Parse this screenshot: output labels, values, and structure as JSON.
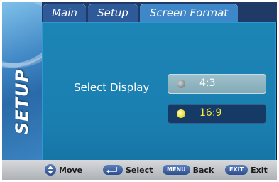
{
  "sidebar": {
    "title": "SETUP"
  },
  "tabs": [
    {
      "label": "Main"
    },
    {
      "label": "Setup"
    },
    {
      "label": "Screen Format"
    }
  ],
  "content": {
    "select_label": "Select Display",
    "options": [
      {
        "label": "4:3",
        "selected": false
      },
      {
        "label": "16:9",
        "selected": true
      }
    ]
  },
  "footer": {
    "move": {
      "label": "Move",
      "icon": "up-down-arrows-icon"
    },
    "select": {
      "label": "Select",
      "icon": "enter-key-icon"
    },
    "back": {
      "key": "MENU",
      "label": "Back"
    },
    "exit": {
      "key": "EXIT",
      "label": "Exit"
    }
  },
  "colors": {
    "content_bg": "#1a7fb0",
    "selected_text": "#ffe83a",
    "tab_active": "#3e87c8"
  }
}
